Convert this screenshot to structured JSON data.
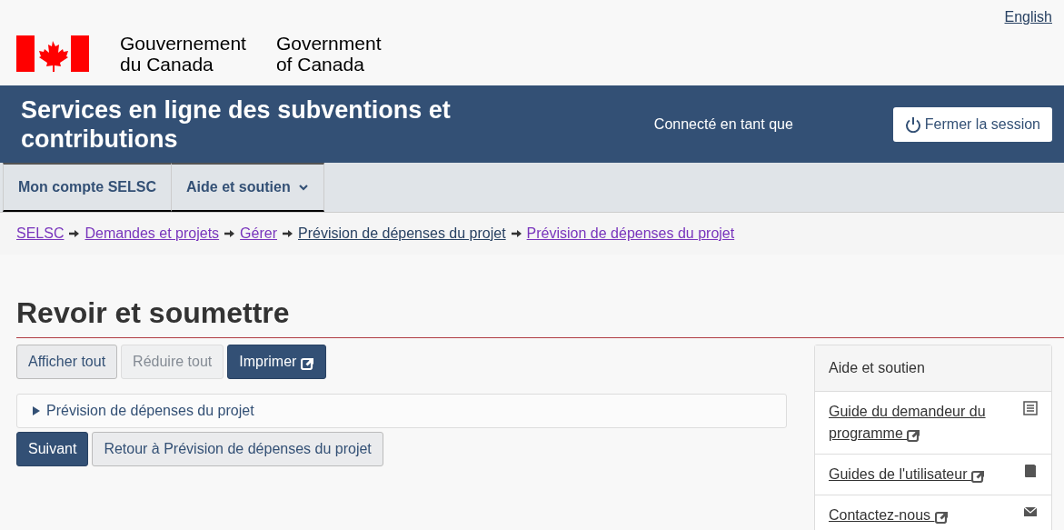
{
  "language_link": "English",
  "signature": {
    "fr": [
      "Gouvernement",
      "du Canada"
    ],
    "en": [
      "Government",
      "of Canada"
    ]
  },
  "banner": {
    "title": "Services en ligne des subventions et contributions",
    "signed_in": "Connecté en tant que",
    "logout": "Fermer la session"
  },
  "menu": [
    {
      "label": "Mon compte SELSC",
      "dropdown": false
    },
    {
      "label": "Aide et soutien",
      "dropdown": true
    }
  ],
  "breadcrumb": [
    {
      "label": "SELSC",
      "visited": true
    },
    {
      "label": "Demandes et projets",
      "visited": true
    },
    {
      "label": "Gérer",
      "visited": true
    },
    {
      "label": "Prévision de dépenses du projet",
      "visited": false
    },
    {
      "label": "Prévision de dépenses du projet",
      "visited": true
    }
  ],
  "heading": "Revoir et soumettre",
  "toolbar": [
    {
      "label": "Afficher tout",
      "kind": "default",
      "disabled": false,
      "external": false
    },
    {
      "label": "Réduire tout",
      "kind": "default",
      "disabled": true,
      "external": false
    },
    {
      "label": "Imprimer",
      "kind": "primary",
      "disabled": false,
      "external": true
    }
  ],
  "sections": [
    {
      "label": "Prévision de dépenses du projet",
      "expanded": false
    }
  ],
  "actions": [
    {
      "label": "Suivant",
      "kind": "primary"
    },
    {
      "label": "Retour à Prévision de dépenses du projet",
      "kind": "default"
    }
  ],
  "help_panel": {
    "title": "Aide et soutien",
    "items": [
      {
        "label": "Guide du demandeur du programme",
        "kind": "list"
      },
      {
        "label": "Guides de l'utilisateur",
        "kind": "book"
      },
      {
        "label": "Contactez-nous",
        "kind": "mail"
      }
    ]
  }
}
